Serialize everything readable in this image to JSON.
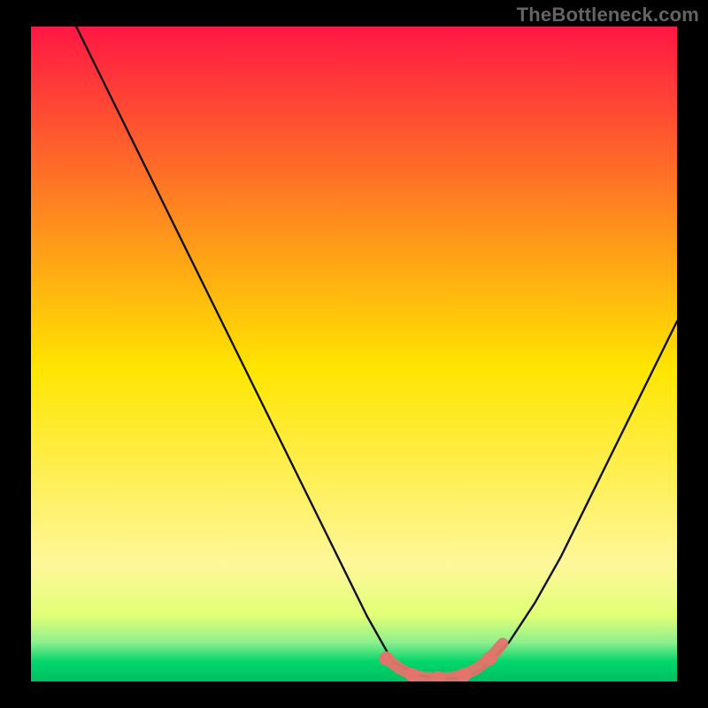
{
  "watermark": "TheBottleneck.com",
  "colors": {
    "background": "#000000",
    "watermark_text": "#646464",
    "curve": "#111111",
    "highlight": "#e2746c",
    "grad_top": "#ff1744",
    "grad_mid": "#ffe500",
    "grad_green_a": "#e0ff76",
    "grad_green_b": "#8ef08e",
    "grad_green_c": "#00d66b",
    "grad_green_d": "#00c060"
  },
  "chart_data": {
    "type": "line",
    "title": "",
    "xlabel": "",
    "ylabel": "",
    "xlim": [
      0,
      100
    ],
    "ylim": [
      0,
      100
    ],
    "series": [
      {
        "name": "bottleneck-curve",
        "x": [
          7,
          12,
          17,
          22,
          27,
          32,
          37,
          42,
          47,
          52,
          56,
          58,
          60,
          62,
          64,
          66,
          68,
          70,
          74,
          78,
          82,
          86,
          90,
          94,
          98,
          100
        ],
        "y": [
          100,
          90,
          80,
          70,
          60,
          50,
          40,
          30,
          20,
          10,
          3,
          2,
          1,
          0.5,
          0.5,
          0.5,
          1,
          2,
          6,
          12,
          19,
          27,
          35,
          43,
          51,
          55
        ]
      }
    ],
    "highlight_segment": {
      "x": [
        55,
        57,
        59,
        61,
        63,
        65,
        67,
        69,
        71,
        73
      ],
      "y": [
        3.5,
        2.0,
        1.0,
        0.6,
        0.5,
        0.6,
        1.0,
        2.0,
        3.5,
        5.8
      ]
    },
    "annotations": []
  }
}
